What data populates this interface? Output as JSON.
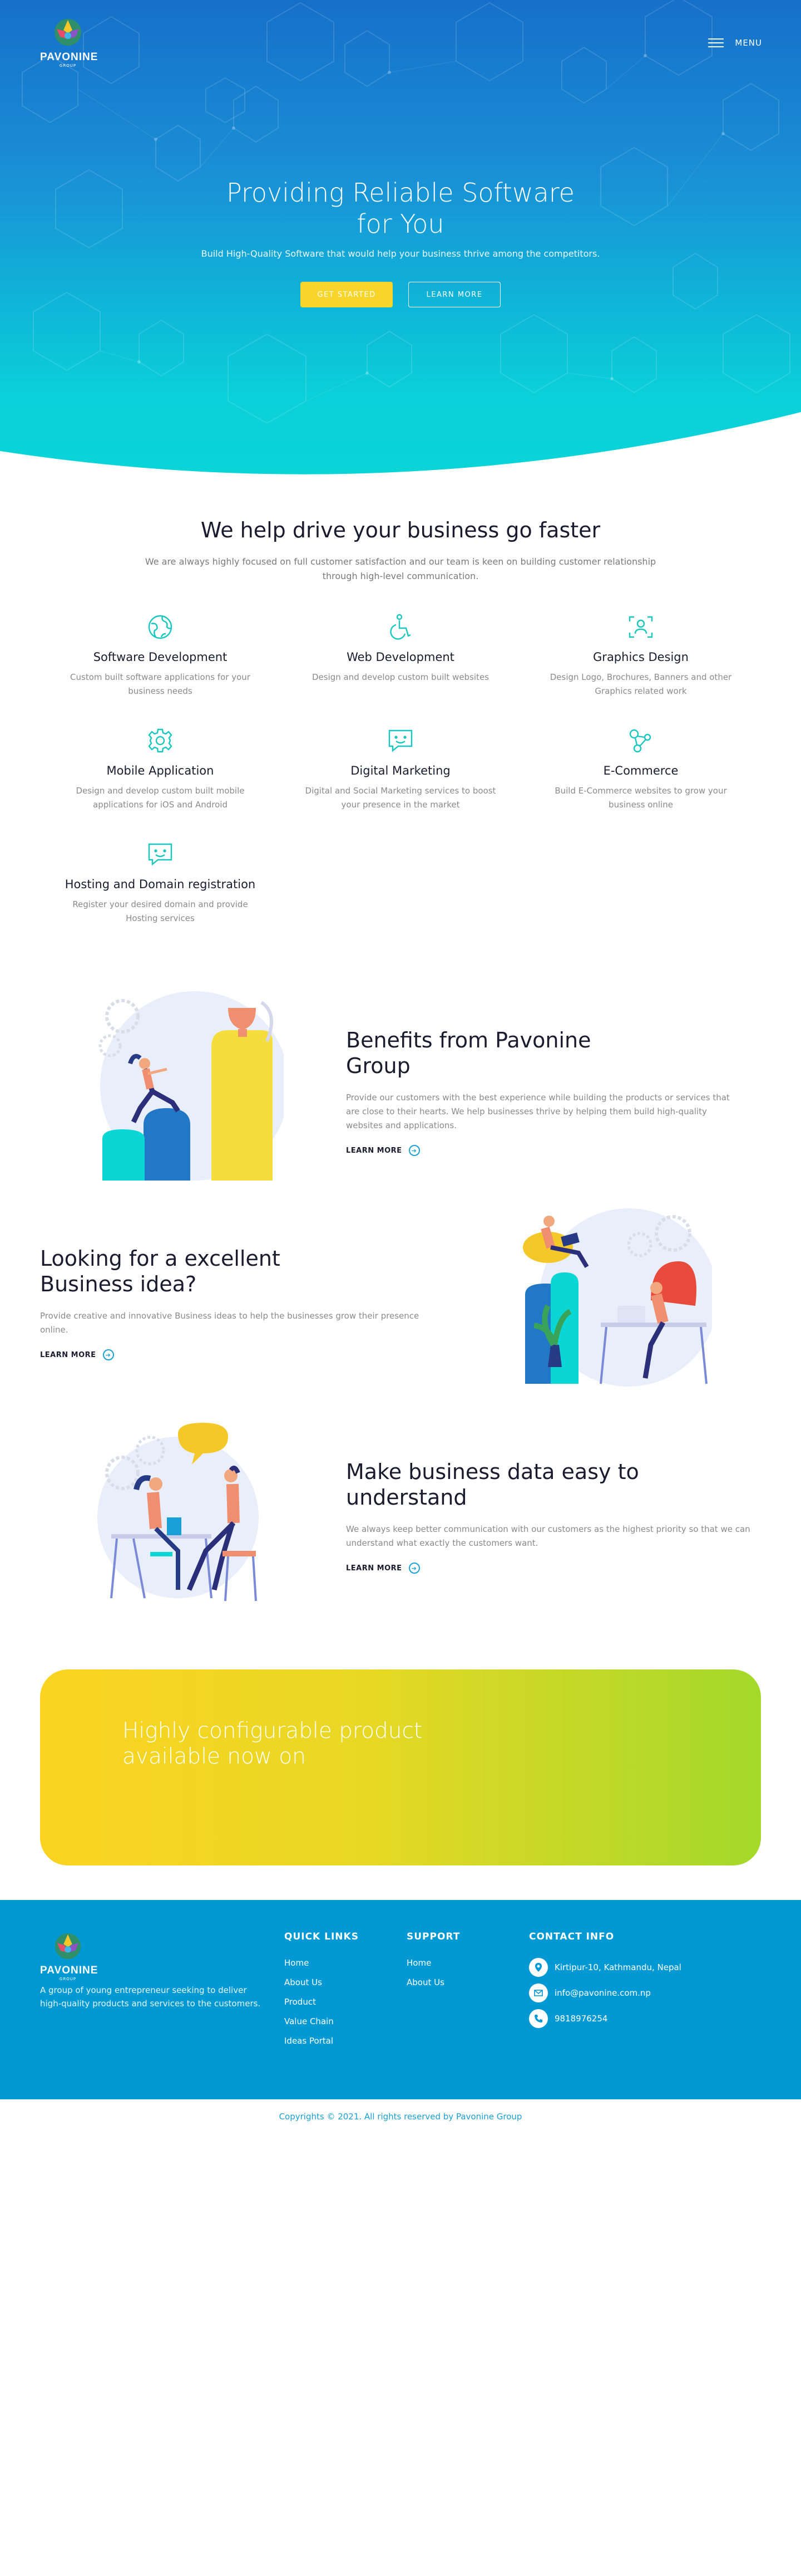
{
  "header": {
    "logo_name": "PAVONINE",
    "logo_sub": "GROUP",
    "menu_label": "MENU"
  },
  "hero": {
    "title_line1": "Providing Reliable Software",
    "title_line2": "for You",
    "subtitle": "Build High-Quality Software that would help your business thrive among the competitors.",
    "primary_button": "GET STARTED",
    "secondary_button": "LEARN MORE"
  },
  "services": {
    "title": "We help drive your business go faster",
    "description": "We are always highly focused on full customer satisfaction and our team is keen on building customer relationship through high-level communication.",
    "items": [
      {
        "title": "Software Development",
        "desc": "Custom built software applications for your business needs",
        "icon": "globe-icon"
      },
      {
        "title": "Web Development",
        "desc": "Design and develop custom built websites",
        "icon": "accessibility-icon"
      },
      {
        "title": "Graphics Design",
        "desc": "Design Logo, Brochures, Banners and other Graphics related work",
        "icon": "user-scan-icon"
      },
      {
        "title": "Mobile Application",
        "desc": "Design and develop custom built mobile applications for iOS and Android",
        "icon": "gear-icon"
      },
      {
        "title": "Digital Marketing",
        "desc": "Digital and Social Marketing services to boost your presence in the market",
        "icon": "smiley-chat-icon"
      },
      {
        "title": "E-Commerce",
        "desc": "Build E-Commerce websites to grow your business online",
        "icon": "share-nodes-icon"
      },
      {
        "title": "Hosting and Domain registration",
        "desc": "Register your desired domain and provide Hosting services",
        "icon": "smiley-chat-icon"
      }
    ]
  },
  "features": [
    {
      "title": "Benefits from Pavonine Group",
      "desc": "Provide our customers with the best experience while building the products or services that are close to their hearts. We help businesses thrive by helping them build high-quality websites and applications.",
      "link": "LEARN MORE"
    },
    {
      "title": "Looking for a excellent Business idea?",
      "desc": "Provide creative and innovative Business ideas to help the businesses grow their presence online.",
      "link": "LEARN MORE"
    },
    {
      "title": "Make business data easy to understand",
      "desc": "We always keep better communication with our customers as the highest priority so that we can understand what exactly the customers want.",
      "link": "LEARN MORE"
    }
  ],
  "cta": {
    "title_line1": "Highly configurable product",
    "title_line2": "available now on"
  },
  "footer": {
    "logo_name": "PAVONINE",
    "logo_sub": "GROUP",
    "about": "A group of young entrepreneur seeking to deliver high-quality products and services to the customers.",
    "quick_links_title": "QUICK LINKS",
    "quick_links": [
      "Home",
      "About Us",
      "Product",
      "Value Chain",
      "Ideas Portal"
    ],
    "support_title": "SUPPORT",
    "support_links": [
      "Home",
      "About Us"
    ],
    "contact_title": "CONTACT INFO",
    "address": "Kirtipur-10, Kathmandu, Nepal",
    "email": "info@pavonine.com.np",
    "phone": "9818976254",
    "copyright": "Copyrights © 2021. All rights reserved by Pavonine Group"
  },
  "colors": {
    "accent_teal": "#18c6c0",
    "brand_blue": "#0099d4",
    "button_yellow": "#f7d52a",
    "cta_green": "#a3d92a"
  }
}
